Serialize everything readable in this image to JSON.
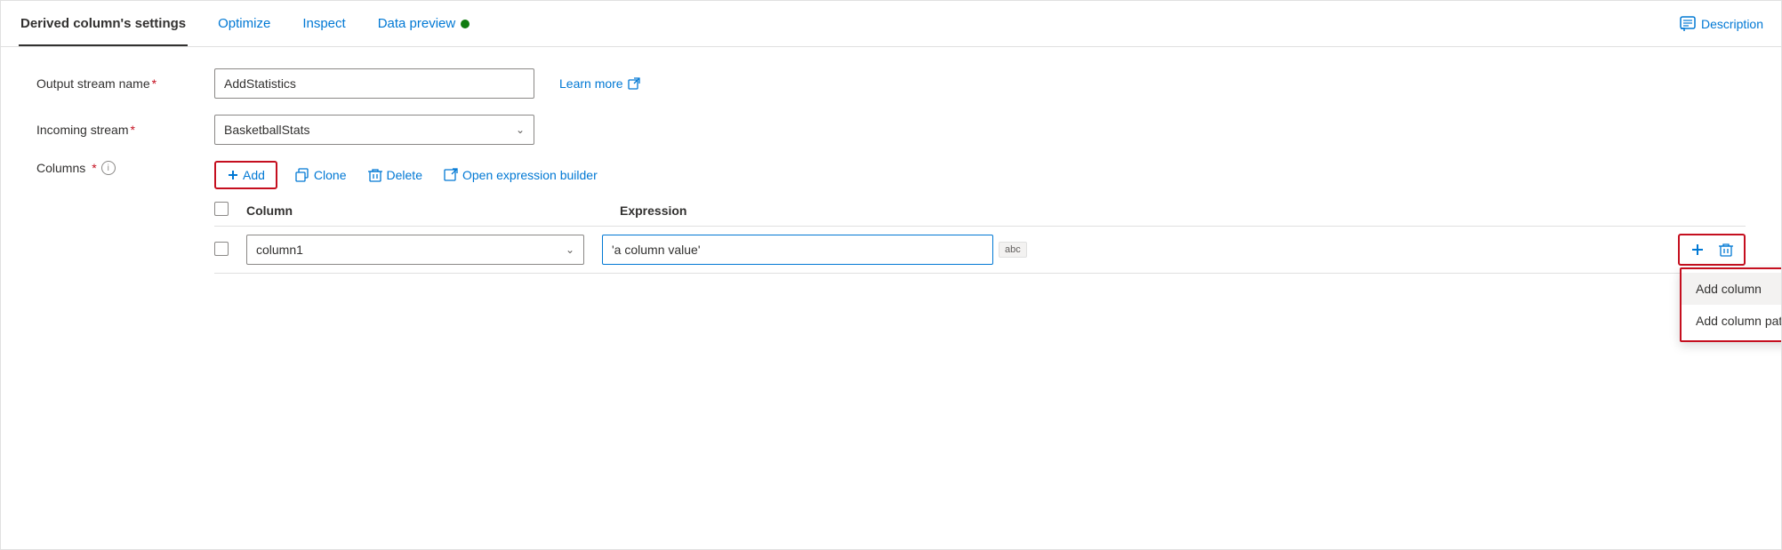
{
  "tabs": {
    "items": [
      {
        "label": "Derived column's settings",
        "active": true
      },
      {
        "label": "Optimize",
        "active": false
      },
      {
        "label": "Inspect",
        "active": false
      },
      {
        "label": "Data preview",
        "active": false
      }
    ],
    "data_preview_dot_color": "#107c10",
    "description_label": "Description"
  },
  "form": {
    "output_stream_label": "Output stream name",
    "output_stream_required": "*",
    "output_stream_value": "AddStatistics",
    "learn_more_label": "Learn more",
    "incoming_stream_label": "Incoming stream",
    "incoming_stream_required": "*",
    "incoming_stream_value": "BasketballStats"
  },
  "toolbar": {
    "add_label": "Add",
    "clone_label": "Clone",
    "delete_label": "Delete",
    "open_expression_builder_label": "Open expression builder"
  },
  "columns": {
    "section_label": "Columns",
    "required": "*",
    "table": {
      "header_check": "",
      "header_column": "Column",
      "header_expression": "Expression",
      "rows": [
        {
          "column_value": "column1",
          "expression_value": "'a column value'",
          "abc_badge": "abc"
        }
      ]
    }
  },
  "action_menu": {
    "add_column_label": "Add column",
    "add_column_pattern_label": "Add column pattern"
  },
  "icons": {
    "plus": "+",
    "clone": "⧉",
    "delete": "🗑",
    "external_link": "↗",
    "chevron_down": "∨",
    "description_chat": "💬",
    "info": "i"
  }
}
